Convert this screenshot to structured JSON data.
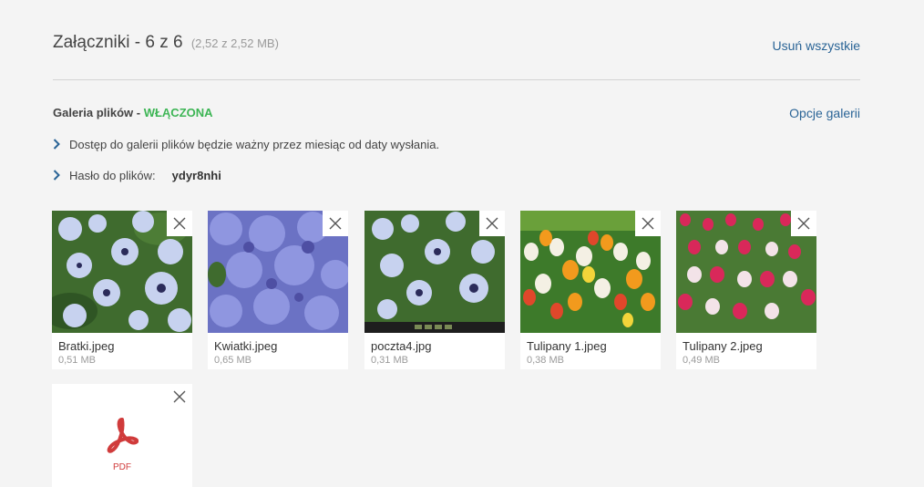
{
  "header": {
    "title": "Załączniki - 6 z 6",
    "size": "(2,52 z 2,52 MB)",
    "remove_all": "Usuń wszystkie"
  },
  "gallery": {
    "label": "Galeria plików - ",
    "status": "WŁĄCZONA",
    "options": "Opcje galerii",
    "status_color": "#3cb554"
  },
  "info": {
    "access_text": "Dostęp do galerii plików będzie ważny przez miesiąc od daty wysłania.",
    "password_label": "Hasło do plików:",
    "password_value": "ydyr8nhi"
  },
  "files": [
    {
      "name": "Bratki.jpeg",
      "size": "0,51 MB"
    },
    {
      "name": "Kwiatki.jpeg",
      "size": "0,65 MB"
    },
    {
      "name": "poczta4.jpg",
      "size": "0,31 MB"
    },
    {
      "name": "Tulipany 1.jpeg",
      "size": "0,38 MB"
    },
    {
      "name": "Tulipany 2.jpeg",
      "size": "0,49 MB"
    }
  ],
  "pdf": {
    "label": "PDF"
  },
  "colors": {
    "link": "#2a6496",
    "accent_green": "#3cb554",
    "pdf_red": "#d03b3b"
  }
}
